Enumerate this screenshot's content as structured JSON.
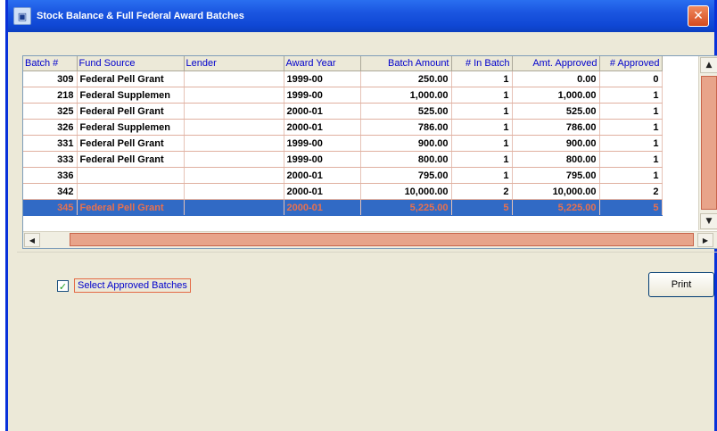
{
  "window": {
    "title": "Stock Balance & Full Federal Award Batches",
    "close_glyph": "✕"
  },
  "grid": {
    "columns": [
      "Batch #",
      "Fund Source",
      "Lender",
      "Award Year",
      "Batch Amount",
      "# In Batch",
      "Amt. Approved",
      "# Approved"
    ],
    "rows": [
      [
        "309",
        "Federal Pell Grant",
        "",
        "1999-00",
        "250.00",
        "1",
        "0.00",
        "0"
      ],
      [
        "218",
        "Federal Supplemen",
        "",
        "1999-00",
        "1,000.00",
        "1",
        "1,000.00",
        "1"
      ],
      [
        "325",
        "Federal Pell Grant",
        "",
        "2000-01",
        "525.00",
        "1",
        "525.00",
        "1"
      ],
      [
        "326",
        "Federal Supplemen",
        "",
        "2000-01",
        "786.00",
        "1",
        "786.00",
        "1"
      ],
      [
        "331",
        "Federal Pell Grant",
        "",
        "1999-00",
        "900.00",
        "1",
        "900.00",
        "1"
      ],
      [
        "333",
        "Federal Pell Grant",
        "",
        "1999-00",
        "800.00",
        "1",
        "800.00",
        "1"
      ],
      [
        "336",
        "",
        "",
        "2000-01",
        "795.00",
        "1",
        "795.00",
        "1"
      ],
      [
        "342",
        "",
        "",
        "2000-01",
        "10,000.00",
        "2",
        "10,000.00",
        "2"
      ],
      [
        "345",
        "Federal Pell Grant",
        "",
        "2000-01",
        "5,225.00",
        "5",
        "5,225.00",
        "5"
      ]
    ],
    "selected_row_index": 8
  },
  "select_approved": {
    "label": "Select Approved Batches",
    "checked": true,
    "check_glyph": "✓"
  },
  "print_button": {
    "label": "Print"
  },
  "scroll": {
    "up": "▲",
    "down": "▼",
    "left": "◀",
    "right": "▶"
  },
  "colors": {
    "titlebar": "#0f47d4",
    "selection": "#316ac5",
    "highlight": "#e8714f"
  },
  "icons": {
    "app": "app-icon",
    "close": "close-icon"
  }
}
